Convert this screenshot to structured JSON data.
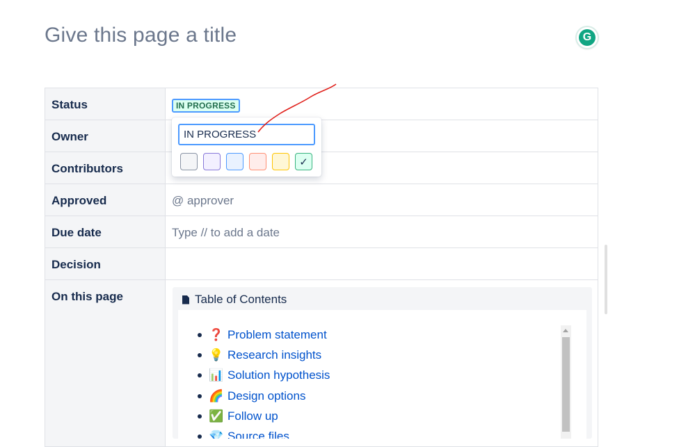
{
  "page": {
    "title_placeholder": "Give this page a title",
    "grammarly_letter": "G"
  },
  "properties": {
    "rows": [
      {
        "label": "Status"
      },
      {
        "label": "Owner"
      },
      {
        "label": "Contributors"
      },
      {
        "label": "Approved",
        "value": "@ approver"
      },
      {
        "label": "Due date",
        "value": "Type // to add a date"
      },
      {
        "label": "Decision",
        "value": ""
      },
      {
        "label": "On this page"
      }
    ],
    "status_lozenge": "IN PROGRESS"
  },
  "status_popup": {
    "input_value": "IN PROGRESS",
    "swatches": [
      {
        "name": "grey",
        "bg": "#f4f5f7",
        "border": "#8993a4",
        "selected": false
      },
      {
        "name": "purple",
        "bg": "#f3f0ff",
        "border": "#8777d9",
        "selected": false
      },
      {
        "name": "blue",
        "bg": "#e9f2ff",
        "border": "#4c9aff",
        "selected": false
      },
      {
        "name": "red",
        "bg": "#ffedeb",
        "border": "#ff8f73",
        "selected": false
      },
      {
        "name": "yellow",
        "bg": "#fff7d6",
        "border": "#ffc400",
        "selected": false
      },
      {
        "name": "green",
        "bg": "#dcfff1",
        "border": "#36b37e",
        "selected": true,
        "check": "✓"
      }
    ]
  },
  "toc": {
    "header": "Table of Contents",
    "items": [
      {
        "emoji": "❓",
        "label": "Problem statement"
      },
      {
        "emoji": "💡",
        "label": "Research insights"
      },
      {
        "emoji": "📊",
        "label": "Solution hypothesis"
      },
      {
        "emoji": "🌈",
        "label": "Design options"
      },
      {
        "emoji": "✅",
        "label": "Follow up"
      },
      {
        "emoji": "💎",
        "label": "Source files"
      }
    ]
  },
  "colors": {
    "link": "#0052cc",
    "annotation": "#e0201b",
    "lozenge_text": "#216e4e",
    "focus": "#4c9aff"
  }
}
